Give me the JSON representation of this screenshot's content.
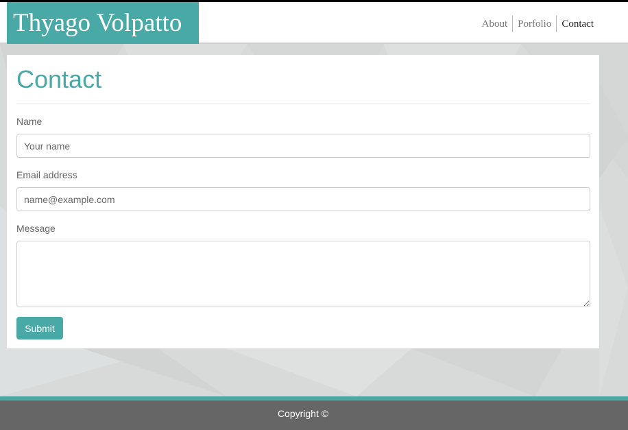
{
  "site": {
    "brand": "Thyago Volpatto"
  },
  "nav": {
    "items": [
      {
        "label": "About"
      },
      {
        "label": "Porfolio"
      },
      {
        "label": "Contact"
      }
    ],
    "active": "Contact"
  },
  "contact": {
    "title": "Contact",
    "name_label": "Name",
    "name_placeholder": "Your name",
    "email_label": "Email address",
    "email_placeholder": "name@example.com",
    "message_label": "Message",
    "submit_label": "Submit"
  },
  "footer": {
    "copyright": "Copyright ©"
  },
  "colors": {
    "accent": "#48a9a6",
    "footer": "#666666",
    "background": "#d9dbdb"
  }
}
